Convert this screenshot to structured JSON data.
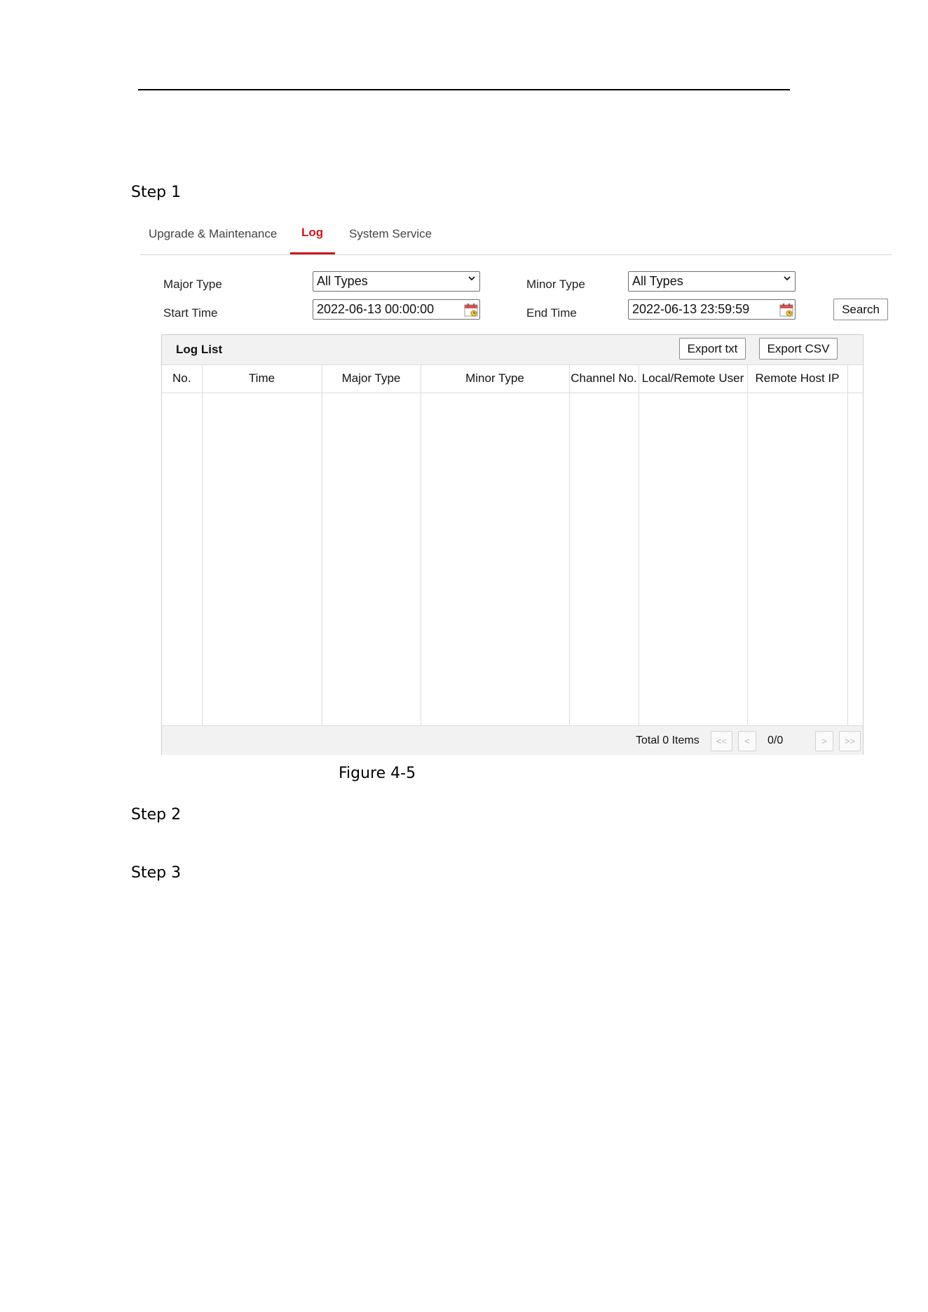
{
  "document": {
    "steps": [
      "Step 1",
      "Step 2",
      "Step 3"
    ],
    "figure_caption": "Figure 4-5"
  },
  "tabs": [
    {
      "label": "Upgrade & Maintenance",
      "active": false
    },
    {
      "label": "Log",
      "active": true
    },
    {
      "label": "System Service",
      "active": false
    }
  ],
  "filters": {
    "major_type_label": "Major Type",
    "major_type_value": "All Types",
    "minor_type_label": "Minor Type",
    "minor_type_value": "All Types",
    "start_time_label": "Start Time",
    "start_time_value": "2022-06-13 00:00:00",
    "end_time_label": "End Time",
    "end_time_value": "2022-06-13 23:59:59",
    "search_label": "Search"
  },
  "log_list": {
    "title": "Log List",
    "export_txt_label": "Export txt",
    "export_csv_label": "Export CSV",
    "columns": [
      "No.",
      "Time",
      "Major Type",
      "Minor Type",
      "Channel No.",
      "Local/Remote User",
      "Remote Host IP"
    ],
    "rows": [],
    "total_text": "Total 0 Items",
    "pager": {
      "first": "<<",
      "prev": "<",
      "page_info": "0/0",
      "next": ">",
      "last": ">>"
    }
  },
  "colors": {
    "accent": "#d0171f",
    "panel_bg": "#f2f2f2",
    "border": "#dcdcdc"
  },
  "icons": [
    "chevron-down-icon",
    "calendar-icon"
  ]
}
